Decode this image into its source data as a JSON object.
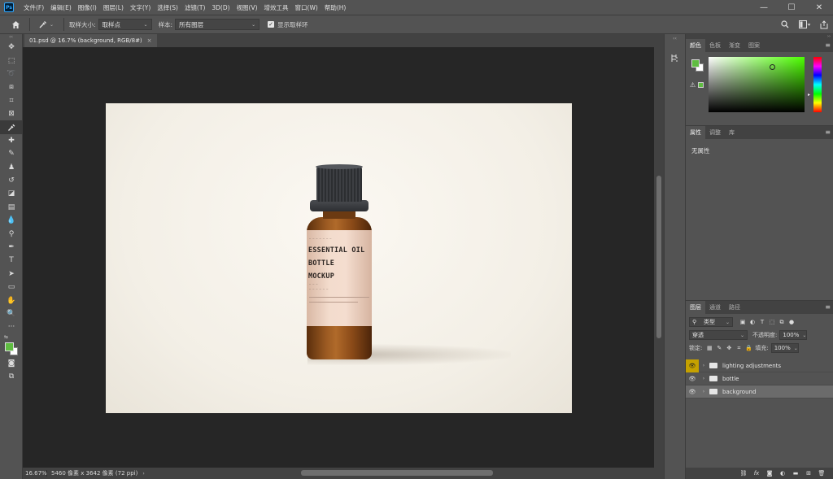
{
  "app": {
    "logo_text": "Ps",
    "menu": [
      "文件(F)",
      "编辑(E)",
      "图像(I)",
      "图层(L)",
      "文字(Y)",
      "选择(S)",
      "滤镜(T)",
      "3D(D)",
      "视图(V)",
      "增效工具",
      "窗口(W)",
      "帮助(H)"
    ],
    "window_controls": {
      "minimize": "—",
      "maximize": "☐",
      "close": "✕"
    }
  },
  "options_bar": {
    "home_icon": "home-icon",
    "tool_icon": "eyedropper-icon",
    "sample_size_label": "取样大小:",
    "sample_size_value": "取样点",
    "sample_label": "样本:",
    "sample_value": "所有图层",
    "show_ring_label": "显示取样环",
    "show_ring_checked": true
  },
  "document": {
    "tab_title": "01.psd @ 16.7% (background, RGB/8#)",
    "tab_close": "×",
    "zoom": "16.67%",
    "info": "5460 像素 x 3642 像素 (72 ppi)"
  },
  "artwork": {
    "label_small_top": "— — — — — — —",
    "label_line1": "ESSENTIAL OIL",
    "label_line2": "BOTTLE",
    "label_line3": "MOCKUP",
    "label_small_mid": "— — —",
    "label_small_ml": "— — — — — —"
  },
  "color_panel": {
    "tabs": [
      "颜色",
      "色板",
      "渐变",
      "图案"
    ],
    "active_tab": 0,
    "foreground": "#5fbd41",
    "background": "#ffffff",
    "hue_marker": "▸"
  },
  "properties_panel": {
    "tabs": [
      "属性",
      "调整",
      "库"
    ],
    "active_tab": 0,
    "body_text": "无属性"
  },
  "layers_panel": {
    "tabs": [
      "图层",
      "通道",
      "路径"
    ],
    "active_tab": 0,
    "filter_label": "类型",
    "blend_mode": "穿透",
    "opacity_label": "不透明度:",
    "opacity_value": "100%",
    "lock_label": "锁定:",
    "fill_label": "填充:",
    "fill_value": "100%",
    "layers": [
      {
        "name": "lighting adjustments",
        "visible": true,
        "highlight_eye": true,
        "selected": false
      },
      {
        "name": "bottle",
        "visible": true,
        "highlight_eye": false,
        "selected": false
      },
      {
        "name": "background",
        "visible": true,
        "highlight_eye": false,
        "selected": true
      }
    ],
    "footer_icons": [
      "link-icon",
      "fx-icon",
      "mask-icon",
      "adjustment-icon",
      "group-icon",
      "new-layer-icon",
      "trash-icon"
    ],
    "footer_fx": "fx"
  }
}
